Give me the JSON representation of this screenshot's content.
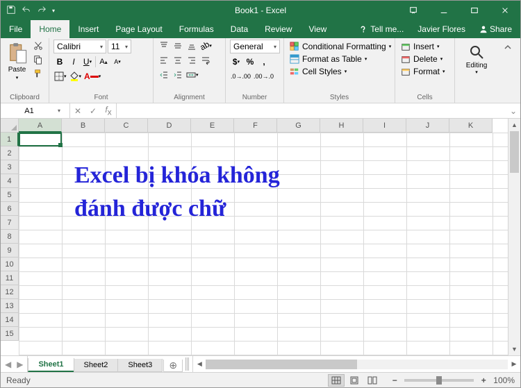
{
  "title": "Book1 - Excel",
  "menu": {
    "file": "File",
    "home": "Home",
    "insert": "Insert",
    "pagelayout": "Page Layout",
    "formulas": "Formulas",
    "data": "Data",
    "review": "Review",
    "view": "View",
    "tellme": "Tell me...",
    "user": "Javier Flores",
    "share": "Share"
  },
  "ribbon": {
    "clipboard": {
      "paste": "Paste",
      "label": "Clipboard"
    },
    "font": {
      "name": "Calibri",
      "size": "11",
      "label": "Font"
    },
    "alignment": {
      "label": "Alignment"
    },
    "number": {
      "format": "General",
      "label": "Number"
    },
    "styles": {
      "condfmt": "Conditional Formatting",
      "table": "Format as Table",
      "cellstyles": "Cell Styles",
      "label": "Styles"
    },
    "cells": {
      "insert": "Insert",
      "delete": "Delete",
      "format": "Format",
      "label": "Cells"
    },
    "editing": {
      "label": "Editing"
    }
  },
  "namebox": "A1",
  "formula": "",
  "columns": [
    "A",
    "B",
    "C",
    "D",
    "E",
    "F",
    "G",
    "H",
    "I",
    "J",
    "K"
  ],
  "rows": [
    "1",
    "2",
    "3",
    "4",
    "5",
    "6",
    "7",
    "8",
    "9",
    "10",
    "11",
    "12",
    "13",
    "14",
    "15"
  ],
  "overlay_text": "Excel bị khóa không\nđánh được chữ",
  "tabs": {
    "s1": "Sheet1",
    "s2": "Sheet2",
    "s3": "Sheet3"
  },
  "status": {
    "ready": "Ready",
    "zoom": "100%"
  }
}
